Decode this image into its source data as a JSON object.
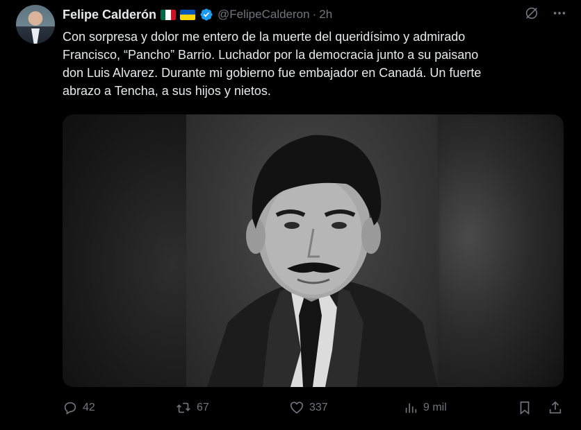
{
  "author": {
    "display_name": "Felipe Calderón",
    "handle": "@FelipeCalderon",
    "separator": "·",
    "time": "2h",
    "flags": [
      "mexico-flag-icon",
      "ukraine-flag-icon"
    ],
    "verified_color": "#1d9bf0"
  },
  "tweet": {
    "text": "Con sorpresa y dolor me entero de la muerte del queridísimo y admirado\nFrancisco, “Pancho” Barrio. Luchador por la democracia junto a su paisano\ndon Luis Alvarez. Durante mi gobierno fue embajador en Canadá. Un fuerte\nabrazo a Tencha, a sus hijos y nietos."
  },
  "media": {
    "type": "photo",
    "description_icon": "black-and-white-portrait"
  },
  "header_actions": [
    "grok-icon",
    "more-icon"
  ],
  "engagement": {
    "replies": "42",
    "reposts": "67",
    "likes": "337",
    "views": "9 mil"
  },
  "colors": {
    "background": "#000000",
    "text": "#e7e9ea",
    "secondary": "#71767b",
    "accent": "#1d9bf0"
  }
}
